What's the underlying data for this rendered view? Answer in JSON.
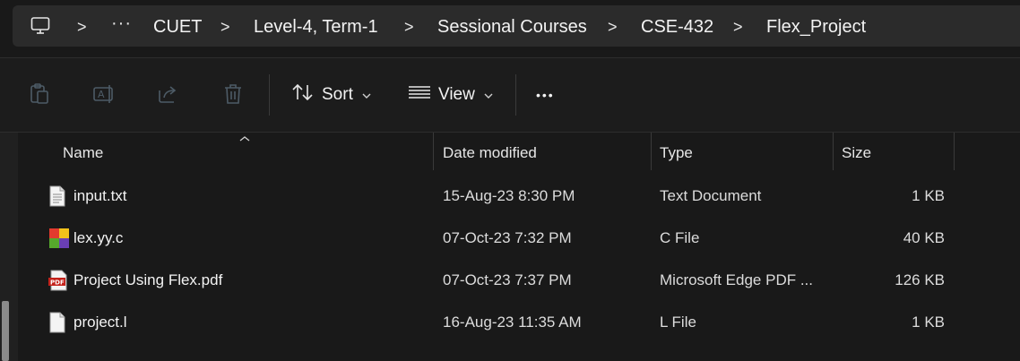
{
  "breadcrumb": {
    "items": [
      "CUET",
      "Level-4, Term-1",
      "Sessional Courses",
      "CSE-432",
      "Flex_Project"
    ],
    "more": "···",
    "separator": ">"
  },
  "toolbar": {
    "sort_label": "Sort",
    "view_label": "View",
    "more_label": "•••",
    "icons": [
      "paste-icon",
      "rename-icon",
      "share-icon",
      "delete-icon",
      "sort-icon",
      "view-icon"
    ]
  },
  "columns": {
    "name": "Name",
    "date": "Date modified",
    "type": "Type",
    "size": "Size"
  },
  "files": [
    {
      "name": "input.txt",
      "date": "15-Aug-23 8:30 PM",
      "type": "Text Document",
      "size": "1 KB",
      "icon": "text-file-icon"
    },
    {
      "name": "lex.yy.c",
      "date": "07-Oct-23 7:32 PM",
      "type": "C File",
      "size": "40 KB",
      "icon": "c-file-icon"
    },
    {
      "name": "Project Using Flex.pdf",
      "date": "07-Oct-23 7:37 PM",
      "type": "Microsoft Edge PDF ...",
      "size": "126 KB",
      "icon": "pdf-file-icon"
    },
    {
      "name": "project.l",
      "date": "16-Aug-23 11:35 AM",
      "type": "L File",
      "size": "1 KB",
      "icon": "blank-file-icon"
    }
  ]
}
